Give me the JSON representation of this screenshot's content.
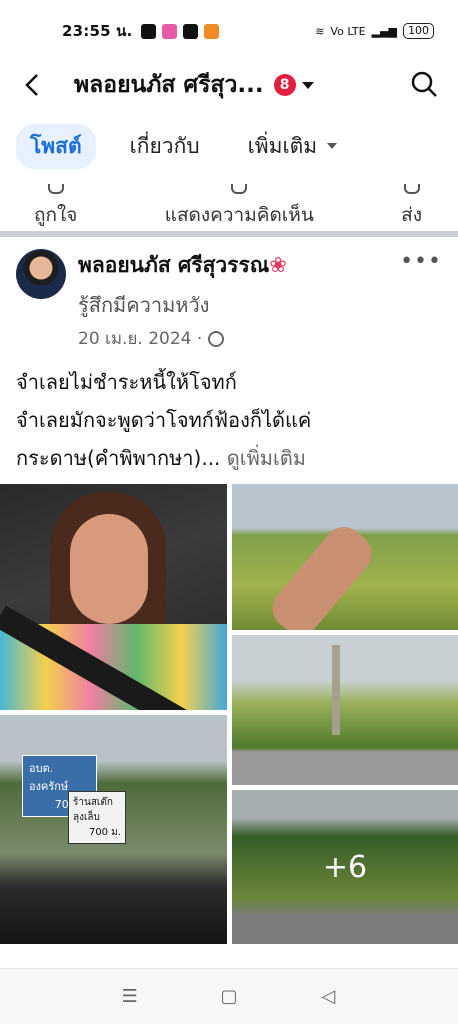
{
  "status_bar": {
    "time": "23:55 น.",
    "network": "Vo LTE",
    "battery": "100"
  },
  "header": {
    "title": "พลอยนภัส ศรีสุว...",
    "notification_count": "8"
  },
  "tabs": [
    {
      "label": "โพสต์"
    },
    {
      "label": "เกี่ยวกับ"
    },
    {
      "label": "เพิ่มเติม"
    }
  ],
  "actions": {
    "like": "ถูกใจ",
    "comment": "แสดงความคิดเห็น",
    "share": "ส่ง"
  },
  "post": {
    "author": "พลอยนภัส ศรีสุวรรณ",
    "feeling": "รู้สึกมีความหวัง",
    "date": "20 เม.ย. 2024 ·",
    "text_line1": "จำเลยไม่ชำระหนี้ให้โจทก์",
    "text_line2": "จำเลยมักจะพูดว่าโจทก์ฟ้องก็ได้แค่",
    "text_line3": "กระดาษ(คำพิพากษา)...",
    "see_more": "ดูเพิ่มเติม",
    "sign1_line1": "อบต. องครักษ์",
    "sign1_line2": "700 ม.",
    "sign2_line1": "ร้านสเต๊กลุงเล็บ",
    "sign2_line2": "700 ม.",
    "more_photos": "+6"
  },
  "colors": {
    "accent": "#1a6ed8",
    "badge": "#e41e3f"
  }
}
